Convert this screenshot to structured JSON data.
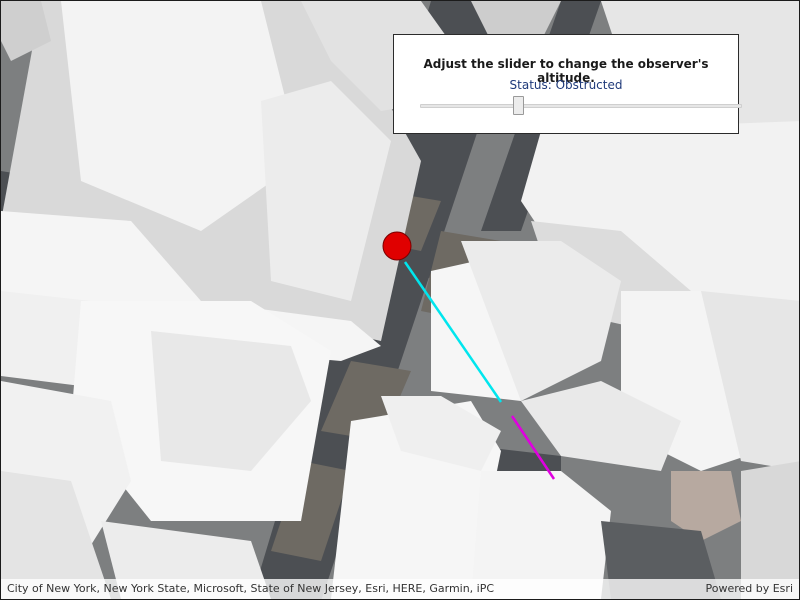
{
  "panel": {
    "instruction": "Adjust the slider to change the observer's altitude.",
    "status": "Status: Obstructed",
    "altitude_fraction": 0.3
  },
  "map": {
    "observer_color": "#e00000",
    "visible_line_color": "#00e6ee",
    "obstructed_line_color": "#e000e0"
  },
  "attribution": {
    "text": "City of New York, New York State, Microsoft, State of New Jersey, Esri, HERE, Garmin, iPC",
    "powered_by": "Powered by Esri"
  }
}
